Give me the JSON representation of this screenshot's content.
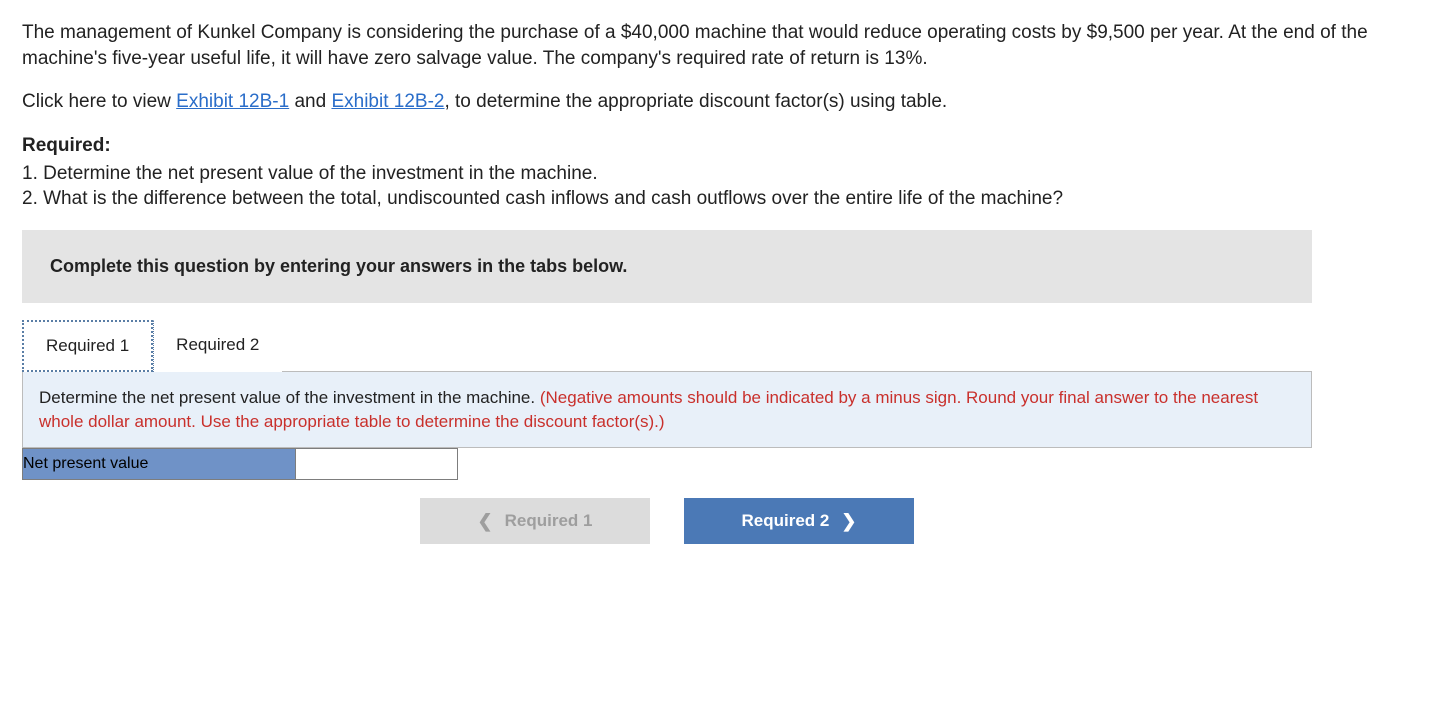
{
  "problem": {
    "para1": "The management of Kunkel Company is considering the purchase of a $40,000 machine that would reduce operating costs by $9,500 per year. At the end of the machine's five-year useful life, it will have zero salvage value. The company's required rate of return is 13%.",
    "para2_prefix": "Click here to view ",
    "exhibit1": "Exhibit 12B-1",
    "para2_mid": " and ",
    "exhibit2": "Exhibit 12B-2",
    "para2_suffix": ", to determine the appropriate discount factor(s) using table.",
    "required_label": "Required:",
    "req1": "1. Determine the net present value of the investment in the machine.",
    "req2": "2. What is the difference between the total, undiscounted cash inflows and cash outflows over the entire life of the machine?"
  },
  "answer_area": {
    "instruction": "Complete this question by entering your answers in the tabs below.",
    "tabs": {
      "tab1": "Required 1",
      "tab2": "Required 2"
    },
    "content": {
      "prompt_black": "Determine the net present value of the investment in the machine. ",
      "prompt_red": "(Negative amounts should be indicated by a minus sign. Round your final answer to the nearest whole dollar amount. Use the appropriate table to determine the discount factor(s).)"
    },
    "input_row": {
      "label": "Net present value",
      "value": ""
    },
    "nav": {
      "prev": "Required 1",
      "next": "Required 2"
    }
  }
}
